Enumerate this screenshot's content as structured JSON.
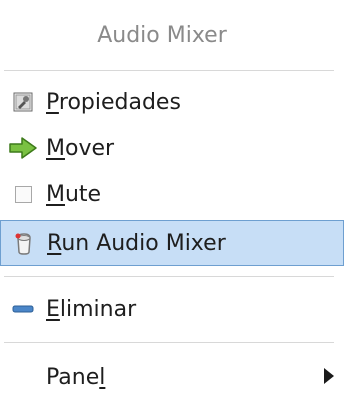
{
  "menu": {
    "title": "Audio Mixer",
    "items": [
      {
        "id": "propiedades",
        "pre": "",
        "u": "P",
        "post": "ropiedades",
        "icon": "properties-icon"
      },
      {
        "id": "mover",
        "pre": "",
        "u": "M",
        "post": "over",
        "icon": "move-arrow-icon"
      },
      {
        "id": "mute",
        "pre": "",
        "u": "M",
        "post": "ute",
        "icon": "checkbox-icon",
        "checked": false
      },
      {
        "id": "run",
        "pre": "",
        "u": "R",
        "post": "un Audio Mixer",
        "icon": "audio-mixer-icon",
        "highlighted": true
      },
      {
        "id": "eliminar",
        "pre": "",
        "u": "E",
        "post": "liminar",
        "icon": "remove-icon"
      },
      {
        "id": "panel",
        "pre": "Pane",
        "u": "l",
        "post": "",
        "icon": "",
        "submenu": true
      }
    ],
    "colors": {
      "highlight": "#c7def6",
      "highlight_border": "#6e9fd0",
      "title": "#8a8a8a"
    }
  }
}
